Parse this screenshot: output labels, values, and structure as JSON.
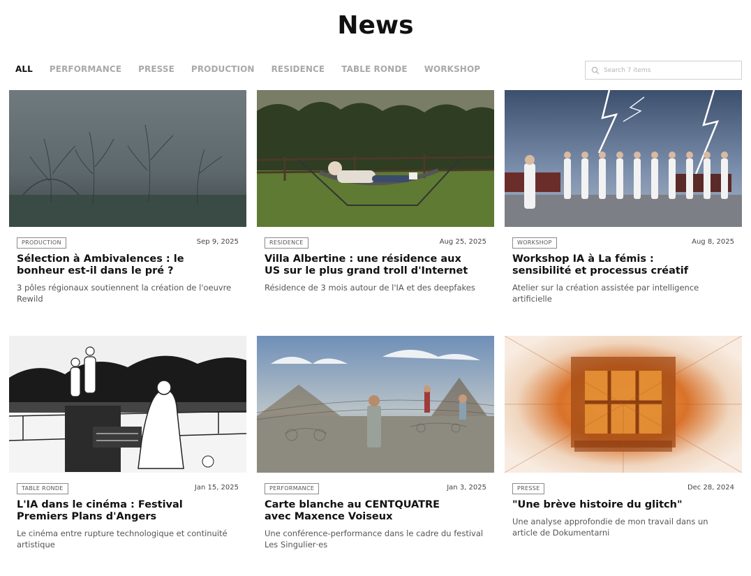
{
  "page": {
    "title": "News"
  },
  "filters": [
    {
      "label": "ALL",
      "active": true
    },
    {
      "label": "PERFORMANCE",
      "active": false
    },
    {
      "label": "PRESSE",
      "active": false
    },
    {
      "label": "PRODUCTION",
      "active": false
    },
    {
      "label": "RESIDENCE",
      "active": false
    },
    {
      "label": "TABLE RONDE",
      "active": false
    },
    {
      "label": "WORKSHOP",
      "active": false
    }
  ],
  "search": {
    "placeholder": "Search 7 items",
    "value": "",
    "icon": "search-icon"
  },
  "cards": [
    {
      "tag": "PRODUCTION",
      "date": "Sep 9, 2025",
      "title_line1": "Sélection à Ambivalences : le",
      "title_line2": "bonheur est-il dans le pré ?",
      "description": "3 pôles régionaux soutiennent la création de l'oeuvre Rewild"
    },
    {
      "tag": "RESIDENCE",
      "date": "Aug 25, 2025",
      "title_line1": "Villa Albertine : une résidence aux",
      "title_line2": "US sur le plus grand troll d'Internet",
      "description": "Résidence de 3 mois autour de l'IA et des deepfakes"
    },
    {
      "tag": "WORKSHOP",
      "date": "Aug 8, 2025",
      "title_line1": "Workshop IA à La fémis :",
      "title_line2": "sensibilité et processus créatif",
      "description": "Atelier sur la création assistée par intelligence artificielle"
    },
    {
      "tag": "TABLE RONDE",
      "date": "Jan 15, 2025",
      "title_line1": "L'IA dans le cinéma : Festival",
      "title_line2": "Premiers Plans d'Angers",
      "description": "Le cinéma entre rupture technologique et continuité artistique"
    },
    {
      "tag": "PERFORMANCE",
      "date": "Jan 3, 2025",
      "title_line1": "Carte blanche au CENTQUATRE",
      "title_line2": "avec Maxence Voiseux",
      "description": "Une conférence-performance dans le cadre du festival Les Singulier·es"
    },
    {
      "tag": "PRESSE",
      "date": "Dec 28, 2024",
      "title_line1": "\"Une brève histoire du glitch\"",
      "title_line2": "",
      "description": "Une analyse approfondie de mon travail dans un article de Dokumentarni"
    }
  ]
}
